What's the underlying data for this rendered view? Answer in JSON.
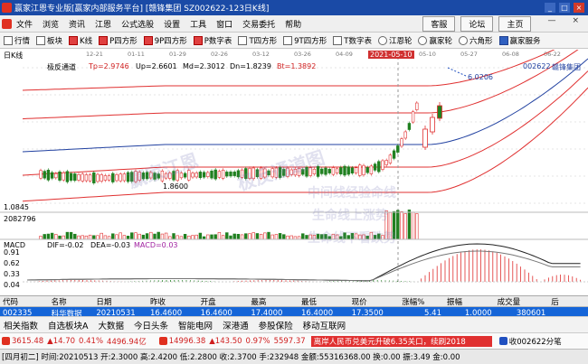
{
  "window": {
    "title": "赢家江恩专业版[赢家内部服务平台] [赣锋集团 SZ002622-123日K线]",
    "min": "_",
    "max": "□",
    "close": "×"
  },
  "menu": {
    "items": [
      "文件",
      "浏览",
      "资讯",
      "江恩",
      "公式选股",
      "设置",
      "工具",
      "窗口",
      "交易委托",
      "帮助"
    ],
    "right_buttons": [
      "客服",
      "论坛",
      "主页"
    ],
    "controls": [
      "—",
      "×"
    ]
  },
  "toolbar": {
    "items": [
      "行情",
      "板块",
      "K线",
      "P四方形",
      "9P四方形",
      "P数字表",
      "T四方形",
      "9T四方形",
      "T数字表",
      "江恩轮",
      "赢家轮",
      "六角形",
      "赢家服务"
    ]
  },
  "chart": {
    "period_label": "日K线",
    "indicator_name": "极反通道",
    "tp_label": "Tp=2.9746",
    "up_label": "Up=2.6601",
    "md_label": "Md=2.3012",
    "dn_label": "Dn=1.8239",
    "bt_label": "Bt=1.3892",
    "date_marker": "2021-05-10",
    "code_label": "002622",
    "stock_name": "赣锋集团",
    "peak_value": "6.0206",
    "low_value": "1.8600",
    "y_axis_low": "1.0845",
    "volume_label": "2082796",
    "watermark_lines": [
      "赢家江恩",
      "极反通道图",
      "中间线经验命线",
      "生命线上涨势",
      "生命线下看跌势"
    ],
    "date_ticks": [
      "12-21",
      "01-11",
      "01-29",
      "02-26",
      "03-12",
      "03-26",
      "04-09",
      "04-23",
      "05-10",
      "05-27",
      "06-08",
      "06-22"
    ]
  },
  "macd": {
    "name": "MACD",
    "dif": "DIF=-0.02",
    "dea": "DEA=-0.03",
    "macd": "MACD=0.03",
    "y_ticks": [
      "0.91",
      "0.62",
      "0.33",
      "0.04"
    ]
  },
  "chart_data": {
    "type": "line",
    "title": "极反通道",
    "channel_values": {
      "Tp": 2.9746,
      "Up": 2.6601,
      "Md": 2.3012,
      "Dn": 1.8239,
      "Bt": 1.3892
    },
    "annotations": [
      "6.0206",
      "1.8600",
      "1.0845"
    ],
    "macd_y_ticks": [
      0.91,
      0.62,
      0.33,
      0.04
    ]
  },
  "quote_table": {
    "headers": [
      "代码",
      "名称",
      "日期",
      "昨收",
      "开盘",
      "最高",
      "最低",
      "现价",
      "涨幅%",
      "振幅",
      "成交量",
      "后"
    ],
    "row": [
      "002335",
      "科华数据",
      "20210531",
      "16.4600",
      "16.4600",
      "17.4000",
      "16.4000",
      "17.3500",
      "5.41",
      "1.0000",
      "380601",
      ""
    ]
  },
  "bottom_nav": {
    "items": [
      "相关指数",
      "自选板块A",
      "大数据",
      "今日头条",
      "智能电网",
      "深港通",
      "参股保险",
      "移动互联网"
    ]
  },
  "index_bar": {
    "sh_value": "3615.48",
    "sh_change": "▲14.70",
    "sh_pct": "0.41%",
    "sh_amount": "4496.94亿",
    "sz_value": "14996.38",
    "sz_change": "▲143.50",
    "sz_pct": "0.97%",
    "sz_amount": "5597.37",
    "ticker_text": "离岸人民币兑美元升破6.35关口，续刷2018",
    "right_text": "收002622分笔"
  },
  "status_bar": {
    "text": "[四月初二] 时间:20210513 开:2.3000 高:2.4200 低:2.2800 收:2.3700 手:232948 金额:55316368.00 换:0.00 振:3.49 金:0.00"
  }
}
